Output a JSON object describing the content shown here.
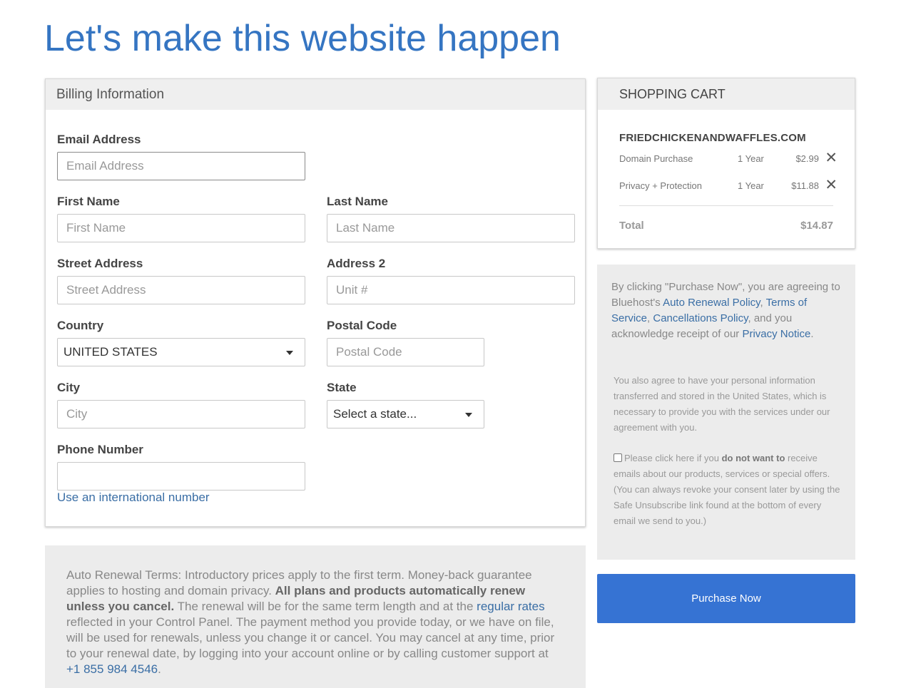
{
  "page": {
    "title": "Let's make this website happen"
  },
  "billing": {
    "heading": "Billing Information",
    "email": {
      "label": "Email Address",
      "placeholder": "Email Address"
    },
    "first_name": {
      "label": "First Name",
      "placeholder": "First Name"
    },
    "last_name": {
      "label": "Last Name",
      "placeholder": "Last Name"
    },
    "street": {
      "label": "Street Address",
      "placeholder": "Street Address"
    },
    "address2": {
      "label": "Address 2",
      "placeholder": "Unit #"
    },
    "country": {
      "label": "Country",
      "value": "UNITED STATES"
    },
    "postal": {
      "label": "Postal Code",
      "placeholder": "Postal Code"
    },
    "city": {
      "label": "City",
      "placeholder": "City"
    },
    "state": {
      "label": "State",
      "value": "Select a state..."
    },
    "phone": {
      "label": "Phone Number",
      "placeholder": ""
    },
    "intl_link": "Use an international number"
  },
  "renewal": {
    "text1": "Auto Renewal Terms: Introductory prices apply to the first term. Money-back guarantee applies to hosting and domain privacy. ",
    "bold": "All plans and products automatically renew unless you cancel.",
    "text2": " The renewal will be for the same term length and at the ",
    "link": "regular rates",
    "text3": " reflected in your Control Panel. The payment method you provide today, or we have on file, will be used for renewals, unless you change it or cancel. You may cancel at any time, prior to your renewal date, by logging into your account online or by calling customer support at ",
    "phone": "+1 855 984 4546",
    "end": "."
  },
  "cart": {
    "heading": "SHOPPING CART",
    "domain": "FRIEDCHICKENANDWAFFLES.COM",
    "items": [
      {
        "name": "Domain Purchase",
        "term": "1 Year",
        "price": "$2.99"
      },
      {
        "name": "Privacy + Protection",
        "term": "1 Year",
        "price": "$11.88"
      }
    ],
    "total_label": "Total",
    "total_value": "$14.87"
  },
  "agreement": {
    "t1": "By clicking \"Purchase Now\", you are agreeing to Bluehost's ",
    "l1": "Auto Renewal Policy",
    "t2": ", ",
    "l2": "Terms of Service",
    "t3": ", ",
    "l3": "Cancellations Policy",
    "t4": ", and you acknowledge receipt of our ",
    "l4": "Privacy Notice",
    "t5": ".",
    "transfer": "You also agree to have your personal information transferred and stored in the United States, which is necessary to provide you with the services under our agreement with you.",
    "opt_a": "Please click here if you ",
    "opt_b": "do not want to",
    "opt_c": " receive emails about our products, services or special offers. (You can always revoke your consent later by using the Safe Unsubscribe link found at the bottom of every email we send to you.)"
  },
  "purchase_button": "Purchase Now",
  "icons": {
    "remove": "close-icon",
    "dropdown": "caret-down-icon"
  }
}
